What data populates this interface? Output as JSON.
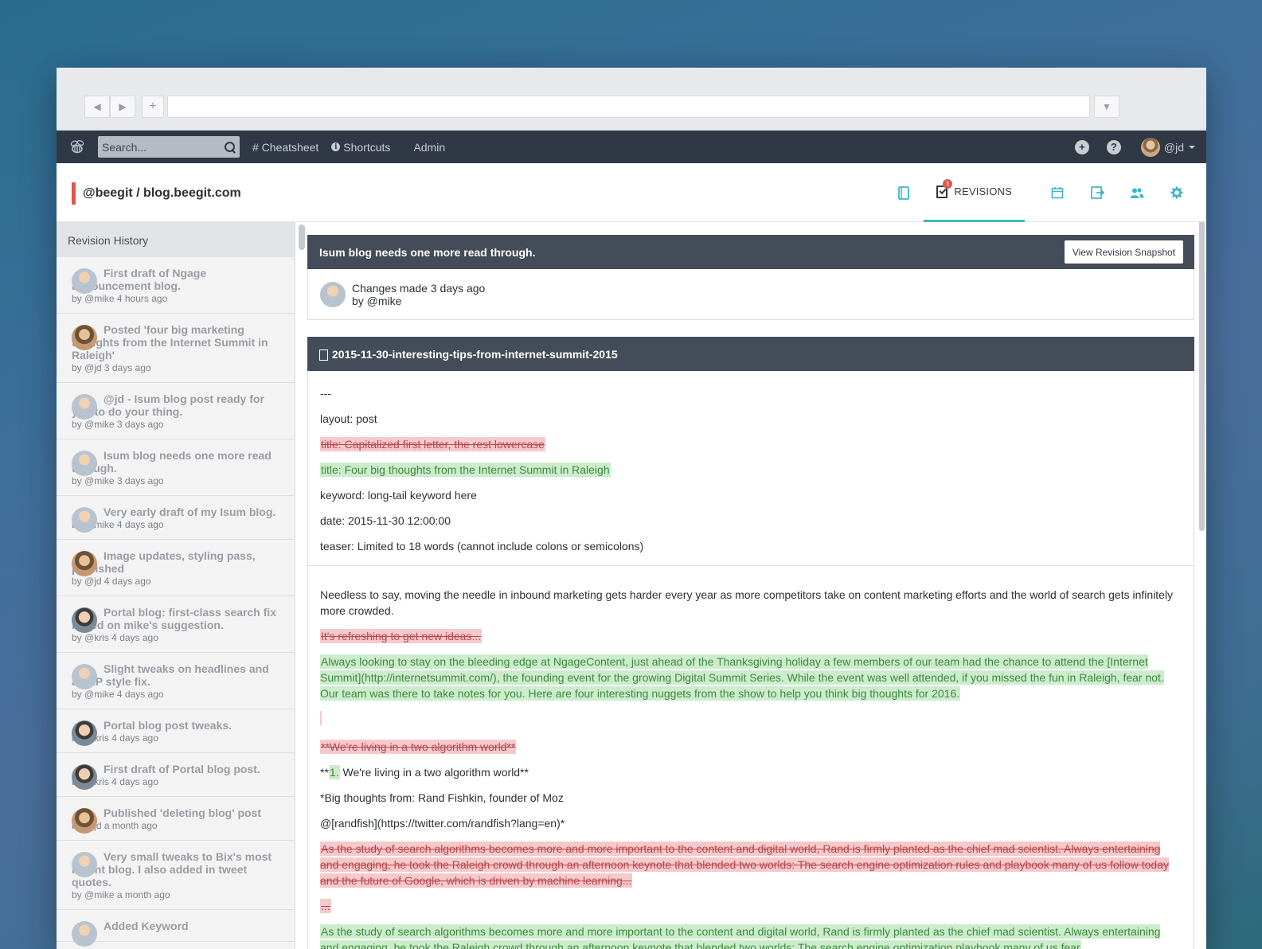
{
  "browser": {
    "back_label": "◀",
    "forward_label": "▶",
    "new_tab_label": "+",
    "menu_label": "▼"
  },
  "topbar": {
    "search_placeholder": "Search...",
    "cheatsheet": "# Cheatsheet",
    "shortcuts": "Shortcuts",
    "admin": "Admin",
    "add_icon": "+",
    "help_icon": "?",
    "user": "@jd"
  },
  "project": {
    "title": "@beegit / blog.beegit.com",
    "active_tab": "REVISIONS",
    "badge": "!"
  },
  "sidebar": {
    "heading": "Revision History",
    "items": [
      {
        "title": "First draft of Ngage announcement blog.",
        "meta": "by @mike 4 hours ago",
        "user": "mike"
      },
      {
        "title": "Posted 'four big marketing thoughts from the Internet Summit in Raleigh'",
        "meta": "by @jd 3 days ago",
        "user": "jd"
      },
      {
        "title": "@jd - Isum blog post ready for you to do your thing.",
        "meta": "by @mike 3 days ago",
        "user": "mike"
      },
      {
        "title": "Isum blog needs one more read through.",
        "meta": "by @mike 3 days ago",
        "user": "mike"
      },
      {
        "title": "Very early draft of my Isum blog.",
        "meta": "by @mike 4 days ago",
        "user": "mike"
      },
      {
        "title": "Image updates, styling pass, published",
        "meta": "by @jd 4 days ago",
        "user": "jd"
      },
      {
        "title": "Portal blog: first-class search fix based on mike's suggestion.",
        "meta": "by @kris 4 days ago",
        "user": "kris"
      },
      {
        "title": "Slight tweaks on headlines and an AP style fix.",
        "meta": "by @mike 4 days ago",
        "user": "mike"
      },
      {
        "title": "Portal blog post tweaks.",
        "meta": "by @kris 4 days ago",
        "user": "kris"
      },
      {
        "title": "First draft of Portal blog post.",
        "meta": "by @kris 4 days ago",
        "user": "kris"
      },
      {
        "title": "Published 'deleting blog' post",
        "meta": "by @jd a month ago",
        "user": "jd"
      },
      {
        "title": "Very small tweaks to Bix's most recent blog. I also added in tweet quotes.",
        "meta": "by @mike a month ago",
        "user": "mike"
      },
      {
        "title": "Added Keyword",
        "meta": "",
        "user": "mike"
      }
    ]
  },
  "revision": {
    "title": "Isum blog needs one more read through.",
    "snapshot_button": "View Revision Snapshot",
    "changes_line1": "Changes made 3 days ago",
    "changes_line2": "by @mike"
  },
  "file": {
    "name": "2015-11-30-interesting-tips-from-internet-summit-2015",
    "front_matter": [
      {
        "type": "same",
        "text": "---"
      },
      {
        "type": "same",
        "text": "layout: post"
      },
      {
        "type": "del",
        "text": "title: Capitalized first letter, the rest lowercase"
      },
      {
        "type": "add",
        "text": "title: Four big thoughts from the Internet Summit in Raleigh"
      },
      {
        "type": "same",
        "text": "keyword: long-tail keyword here"
      },
      {
        "type": "same",
        "text": "date: 2015-11-30 12:00:00"
      },
      {
        "type": "same",
        "text": "teaser: Limited to 18 words (cannot include colons or semicolons)"
      }
    ],
    "body_intro": "Needless to say, moving the needle in inbound marketing gets harder every year as more competitors take on content marketing efforts and the world of search gets infinitely more crowded.",
    "del_ideas": "It's refreshing to get new ideas...",
    "add_intro": "Always looking to stay on the bleeding edge at NgageContent, just ahead of the Thanksgiving holiday a few members of our team had the chance to attend the [Internet Summit](http://internetsummit.com/), the founding event for the growing Digital Summit Series. While the event was well attended, if you missed the fun in Raleigh, fear not. Our team was there to take notes for you. Here are four interesting nuggets from the show to help you think big thoughts for 2016.",
    "del_heading": "**We're living in a two algorithm world**",
    "heading_prefix": "**",
    "heading_add": "1.",
    "heading_rest": " We're living in a two algorithm world**",
    "big_thoughts": "*Big thoughts from: Rand Fishkin, founder of Moz",
    "twitter": "@[randfish](https://twitter.com/randfish?lang=en)*",
    "del_rand": "As the study of search algorithms becomes more and more important to the content and digital world, Rand is firmly planted as the chief mad scientist. Always entertaining and engaging, he took the Raleigh crowd through an afternoon keynote that blended two worlds: The search engine optimization rules and playbook many of us follow today and the future of Google, which is driven by machine learning...",
    "del_ellipsis": "...",
    "add_rand": "As the study of search algorithms becomes more and more important to the content and digital world, Rand is firmly planted as the chief mad scientist. Always entertaining and engaging, he took the Raleigh crowd through an afternoon keynote that blended two worlds: The search engine optimization playbook many of us fear"
  }
}
